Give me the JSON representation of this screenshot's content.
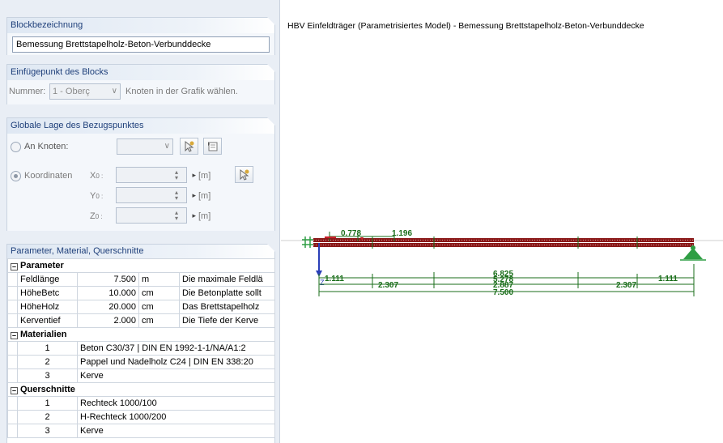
{
  "block_name": {
    "header": "Blockbezeichnung",
    "value": "Bemessung Brettstapelholz-Beton-Verbunddecke"
  },
  "insertion_point": {
    "header": "Einfügepunkt des Blocks",
    "number_label": "Nummer:",
    "number_value": "1 - Oberç",
    "hint": "Knoten in der Grafik wählen."
  },
  "global_position": {
    "header": "Globale Lage des Bezugspunktes",
    "node_radio_label": "An Knoten:",
    "coord_radio_label": "Koordinaten",
    "x_label": "X",
    "x_sub": "0 :",
    "y_label": "Y",
    "y_sub": "0 :",
    "z_label": "Z",
    "z_sub": "0 :",
    "unit": "[m]"
  },
  "params": {
    "header": "Parameter, Material, Querschnitte",
    "sections": {
      "parameter": "Parameter",
      "materials": "Materialien",
      "cross_sections": "Querschnitte"
    },
    "parameter_rows": [
      {
        "name": "Feldlänge",
        "value": "7.500",
        "unit": "m",
        "desc": "Die maximale Feldlä"
      },
      {
        "name": "HöheBetc",
        "value": "10.000",
        "unit": "cm",
        "desc": "Die Betonplatte sollt"
      },
      {
        "name": "HöheHolz",
        "value": "20.000",
        "unit": "cm",
        "desc": "Das Brettstapelholz"
      },
      {
        "name": "Kerventief",
        "value": "2.000",
        "unit": "cm",
        "desc": "Die Tiefe der Kerve"
      }
    ],
    "material_rows": [
      {
        "no": "1",
        "text": "Beton C30/37 | DIN EN 1992-1-1/NA/A1:2"
      },
      {
        "no": "2",
        "text": "Pappel und Nadelholz C24 | DIN EN 338:20"
      },
      {
        "no": "3",
        "text": "Kerve"
      }
    ],
    "cross_section_rows": [
      {
        "no": "1",
        "text": "Rechteck 1000/100"
      },
      {
        "no": "2",
        "text": "H-Rechteck 1000/200"
      },
      {
        "no": "3",
        "text": "Kerve"
      }
    ]
  },
  "graphic": {
    "title": "HBV Einfeldträger (Parametrisiertes Model) - Bemessung Brettstapelholz-Beton-Verbunddecke",
    "top_dims": [
      "0.778",
      "1.196"
    ],
    "dims": [
      "1.111",
      "2.307",
      "6.825",
      "5.278",
      "2.887",
      "2.307",
      "1.111",
      "7.500"
    ],
    "axis_label": "Z"
  },
  "colors": {
    "beam": "#8b1a1a",
    "dimension": "#1a6e1a",
    "support": "#2f9e44",
    "axis": "#2a3fb8",
    "header_text": "#1e3f7a"
  }
}
